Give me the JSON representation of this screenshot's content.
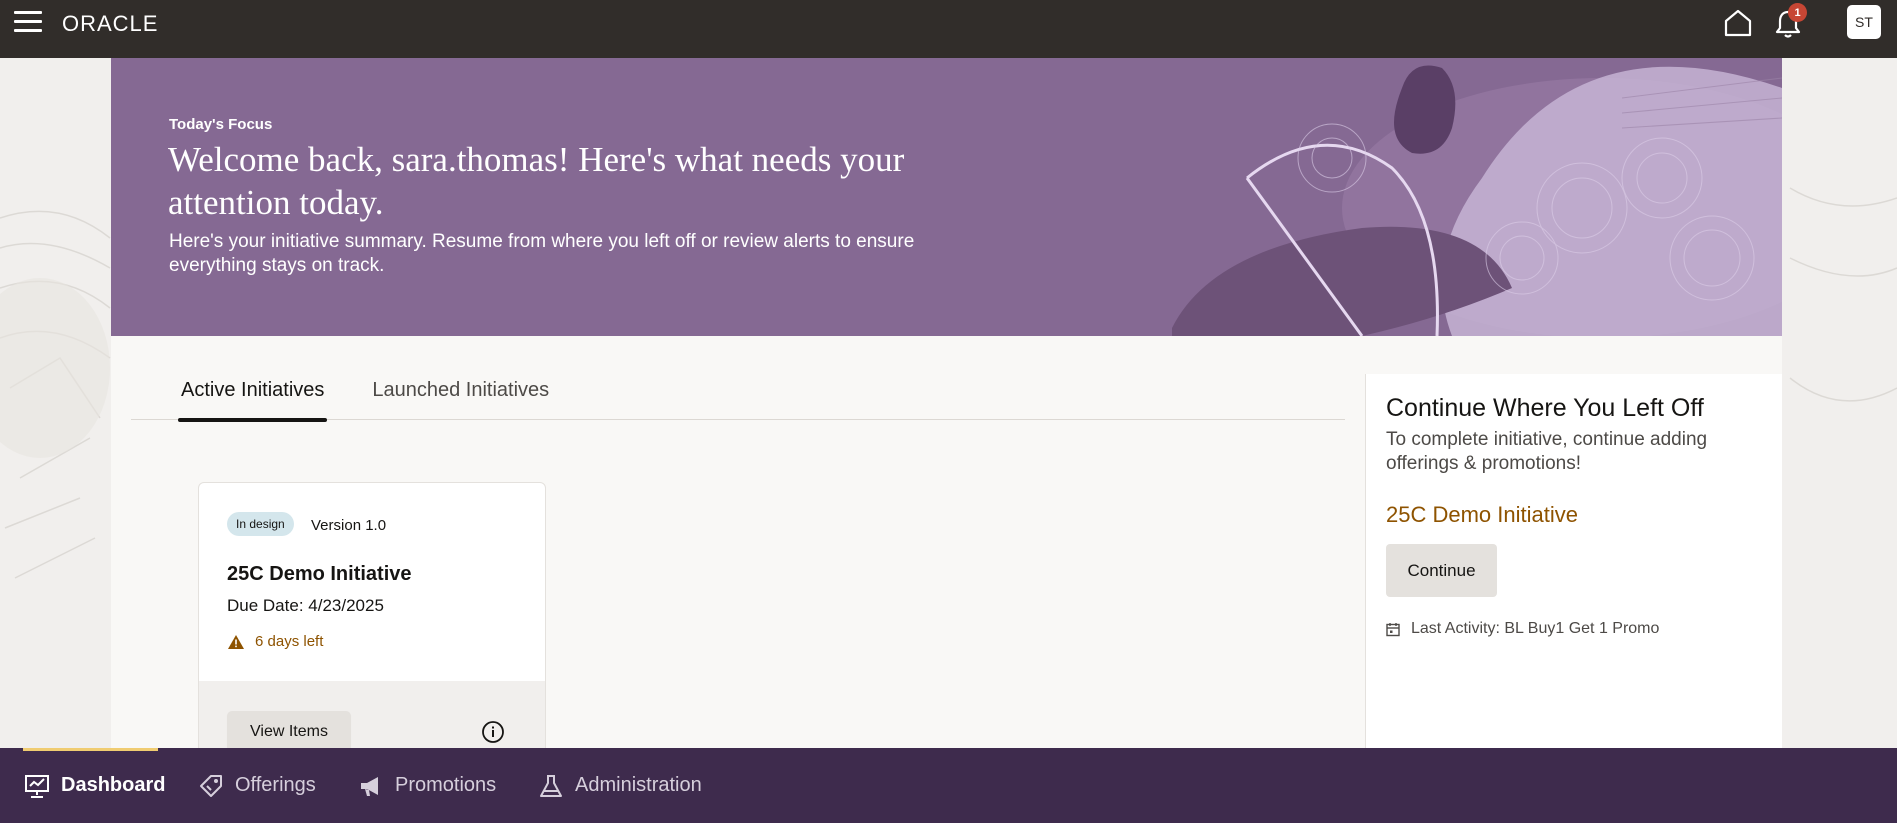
{
  "header": {
    "logo": "ORACLE",
    "notification_count": "1",
    "avatar_initials": "ST"
  },
  "banner": {
    "focus_label": "Today's Focus",
    "welcome": "Welcome back, sara.thomas! Here's what needs your attention today.",
    "subtitle": "Here's your initiative summary. Resume from where you left off or review alerts to ensure everything stays on track.",
    "color": "#856993"
  },
  "tabs": [
    {
      "label": "Active Initiatives",
      "active": true
    },
    {
      "label": "Launched Initiatives",
      "active": false
    }
  ],
  "initiative_card": {
    "status": "In design",
    "version": "Version 1.0",
    "title": "25C Demo Initiative",
    "due_date": "Due Date: 4/23/2025",
    "warning": "6 days left",
    "view_button": "View Items",
    "warning_color": "#8e5300"
  },
  "continue_panel": {
    "title": "Continue Where You Left Off",
    "description": "To complete initiative, continue adding offerings & promotions!",
    "initiative": "25C Demo Initiative",
    "button": "Continue",
    "last_activity": "Last Activity: BL Buy1 Get 1 Promo"
  },
  "bottom_nav": {
    "items": [
      {
        "label": "Dashboard",
        "icon": "dashboard-icon",
        "active": true
      },
      {
        "label": "Offerings",
        "icon": "tag-icon",
        "active": false
      },
      {
        "label": "Promotions",
        "icon": "megaphone-icon",
        "active": false
      },
      {
        "label": "Administration",
        "icon": "flask-icon",
        "active": false
      }
    ],
    "active_indicator_color": "#f0cc71",
    "background": "#3e2b4d"
  }
}
